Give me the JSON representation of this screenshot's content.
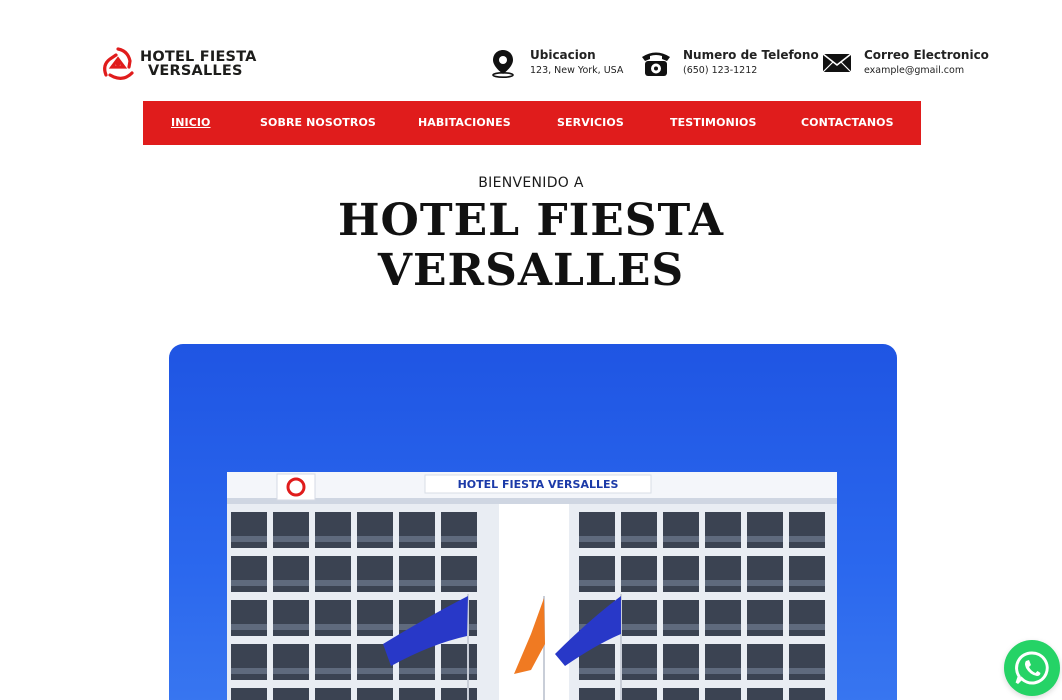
{
  "brand": {
    "line1": "HOTEL FIESTA",
    "line2": "VERSALLES",
    "accent": "#e01c1c"
  },
  "contacts": [
    {
      "icon": "map-pin-icon",
      "title": "Ubicacion",
      "detail": "123, New York, USA"
    },
    {
      "icon": "telephone-icon",
      "title": "Numero de Telefono",
      "detail": "(650) 123-1212"
    },
    {
      "icon": "envelope-icon",
      "title": "Correo Electronico",
      "detail": "example@gmail.com"
    }
  ],
  "nav": {
    "items": [
      {
        "label": "INICIO",
        "active": true
      },
      {
        "label": "SOBRE NOSOTROS",
        "active": false
      },
      {
        "label": "HABITACIONES",
        "active": false
      },
      {
        "label": "SERVICIOS",
        "active": false
      },
      {
        "label": "TESTIMONIOS",
        "active": false
      },
      {
        "label": "CONTACTANOS",
        "active": false
      }
    ]
  },
  "hero": {
    "welcome": "BIENVENIDO A",
    "title_line1": "HOTEL FIESTA",
    "title_line2": "VERSALLES",
    "image_sign": "HOTEL FIESTA VERSALLES"
  },
  "floating": {
    "icon": "whatsapp-icon"
  }
}
